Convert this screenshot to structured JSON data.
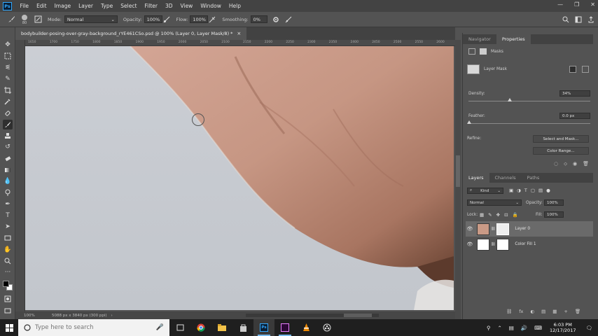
{
  "menubar": {
    "logo": "Ps",
    "items": [
      "File",
      "Edit",
      "Image",
      "Layer",
      "Type",
      "Select",
      "Filter",
      "3D",
      "View",
      "Window",
      "Help"
    ],
    "controls": [
      "—",
      "❐",
      "✕"
    ]
  },
  "options": {
    "size_value": "80",
    "mode_label": "Mode:",
    "mode_value": "Normal",
    "opacity_label": "Opacity:",
    "opacity_value": "100%",
    "flow_label": "Flow:",
    "flow_value": "100%",
    "smoothing_label": "Smoothing:",
    "smoothing_value": "0%"
  },
  "document": {
    "tab_title": "bodybuilder-posing-over-gray-background_rYE461CSo.psd @ 100% (Layer 0, Layer Mask/8) *",
    "tab_close": "×",
    "ruler_ticks": [
      "1650",
      "1700",
      "1750",
      "1800",
      "1850",
      "1900",
      "1950",
      "2000",
      "2050",
      "2100",
      "2150",
      "2200",
      "2250",
      "2300",
      "2350",
      "2400",
      "2450",
      "2500",
      "2550",
      "2600"
    ],
    "zoom": "100%",
    "doc_info": "5088 px x 3840 px (300 ppi)"
  },
  "panels": {
    "top_tabs": [
      "Navigator",
      "Properties"
    ],
    "masks_label": "Masks",
    "layer_mask_label": "Layer Mask",
    "density_label": "Density:",
    "density_value": "34%",
    "density_level": 0.34,
    "feather_label": "Feather:",
    "feather_value": "0.0 px",
    "refine_label": "Refine:",
    "select_mask_button": "Select and Mask...",
    "color_range_button": "Color Range...",
    "layer_tabs": [
      "Layers",
      "Channels",
      "Paths"
    ],
    "kind_label": "Kind",
    "blend_mode": "Normal",
    "opacity_label": "Opacity:",
    "opacity_value": "100%",
    "lock_label": "Lock:",
    "fill_label": "Fill:",
    "fill_value": "100%",
    "layers": [
      {
        "name": "Layer 0",
        "selected": true
      },
      {
        "name": "Color Fill 1",
        "selected": false
      }
    ],
    "bottom_icons": [
      "fx",
      "◐",
      "▤",
      "▦",
      "+",
      "🗑"
    ]
  },
  "taskbar": {
    "search_placeholder": "Type here to search",
    "time": "6:03 PM",
    "date": "12/17/2017"
  },
  "colors": {
    "canvas_bg": "#c9ccd2",
    "skin": "#c99a86",
    "ui_dark": "#535353",
    "accent": "#31a8ff"
  }
}
